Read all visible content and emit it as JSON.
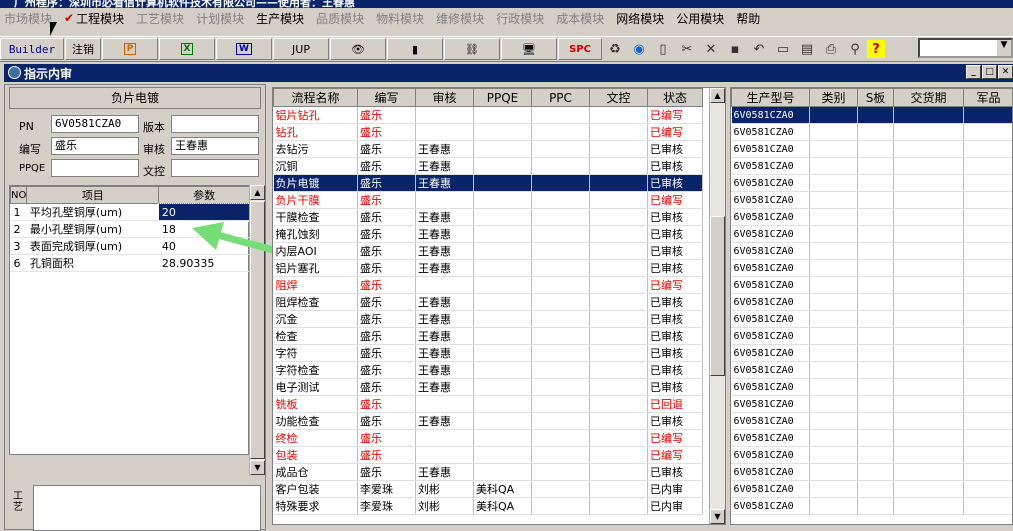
{
  "app": {
    "title": "广州程序：深圳市必看信计算机软件技术有限公司——使用者：王春惠"
  },
  "menu": [
    "市场模块",
    "工程模块",
    "工艺模块",
    "计划模块",
    "生产模块",
    "品质模块",
    "物料模块",
    "维修模块",
    "行政模块",
    "成本模块",
    "网络模块",
    "公用模块",
    "帮助"
  ],
  "toolbar": {
    "builder": "Builder",
    "logout": "注销",
    "jup": "JUP",
    "spc": "SPC"
  },
  "window": {
    "title": "指示内审"
  },
  "header": {
    "title": "负片电镀"
  },
  "form": {
    "pn_label": "PN",
    "pn_value": "6V0581CZA0",
    "version_label": "版本",
    "version_value": "",
    "author_label": "编写",
    "author_value": "盛乐",
    "review_label": "审核",
    "review_value": "王春惠",
    "ppqe_label": "PPQE",
    "ppqe_value": "",
    "control_label": "文控",
    "control_value": ""
  },
  "params": {
    "columns": [
      "NO",
      "项目",
      "参数"
    ],
    "rows": [
      {
        "no": "1",
        "item": "平均孔壁铜厚(um)",
        "value": "20"
      },
      {
        "no": "2",
        "item": "最小孔壁铜厚(um)",
        "value": "18"
      },
      {
        "no": "3",
        "item": "表面完成铜厚(um)",
        "value": "40"
      },
      {
        "no": "6",
        "item": "孔铜面积",
        "value": "28.90335"
      }
    ]
  },
  "side_label": "工艺",
  "flow": {
    "columns": [
      "流程名称",
      "编写",
      "审核",
      "PPQE",
      "PPC",
      "文控",
      "状态"
    ],
    "rows": [
      {
        "name": "铝片钻孔",
        "author": "盛乐",
        "review": "",
        "ppqe": "",
        "status": "已编写",
        "red": true
      },
      {
        "name": "钻孔",
        "author": "盛乐",
        "review": "",
        "ppqe": "",
        "status": "已编写",
        "red": true
      },
      {
        "name": "去钻污",
        "author": "盛乐",
        "review": "王春惠",
        "ppqe": "",
        "status": "已审核"
      },
      {
        "name": "沉铜",
        "author": "盛乐",
        "review": "王春惠",
        "ppqe": "",
        "status": "已审核"
      },
      {
        "name": "负片电镀",
        "author": "盛乐",
        "review": "王春惠",
        "ppqe": "",
        "status": "已审核",
        "hl": true
      },
      {
        "name": "负片干膜",
        "author": "盛乐",
        "review": "",
        "ppqe": "",
        "status": "已编写",
        "red": true
      },
      {
        "name": "干膜检查",
        "author": "盛乐",
        "review": "王春惠",
        "ppqe": "",
        "status": "已审核"
      },
      {
        "name": "掩孔蚀刻",
        "author": "盛乐",
        "review": "王春惠",
        "ppqe": "",
        "status": "已审核"
      },
      {
        "name": "内层AOI",
        "author": "盛乐",
        "review": "王春惠",
        "ppqe": "",
        "status": "已审核"
      },
      {
        "name": "铝片塞孔",
        "author": "盛乐",
        "review": "王春惠",
        "ppqe": "",
        "status": "已审核"
      },
      {
        "name": "阻焊",
        "author": "盛乐",
        "review": "",
        "ppqe": "",
        "status": "已编写",
        "red": true
      },
      {
        "name": "阻焊检查",
        "author": "盛乐",
        "review": "王春惠",
        "ppqe": "",
        "status": "已审核"
      },
      {
        "name": "沉金",
        "author": "盛乐",
        "review": "王春惠",
        "ppqe": "",
        "status": "已审核"
      },
      {
        "name": "检查",
        "author": "盛乐",
        "review": "王春惠",
        "ppqe": "",
        "status": "已审核"
      },
      {
        "name": "字符",
        "author": "盛乐",
        "review": "王春惠",
        "ppqe": "",
        "status": "已审核"
      },
      {
        "name": "字符检查",
        "author": "盛乐",
        "review": "王春惠",
        "ppqe": "",
        "status": "已审核"
      },
      {
        "name": "电子测试",
        "author": "盛乐",
        "review": "王春惠",
        "ppqe": "",
        "status": "已审核"
      },
      {
        "name": "铣板",
        "author": "盛乐",
        "review": "",
        "ppqe": "",
        "status": "已回退",
        "red": true
      },
      {
        "name": "功能检查",
        "author": "盛乐",
        "review": "王春惠",
        "ppqe": "",
        "status": "已审核"
      },
      {
        "name": "终检",
        "author": "盛乐",
        "review": "",
        "ppqe": "",
        "status": "已编写",
        "red": true
      },
      {
        "name": "包装",
        "author": "盛乐",
        "review": "",
        "ppqe": "",
        "status": "已编写",
        "red": true
      },
      {
        "name": "成品仓",
        "author": "盛乐",
        "review": "王春惠",
        "ppqe": "",
        "status": "已审核"
      },
      {
        "name": "客户包装",
        "author": "李爱珠",
        "review": "刘彬",
        "ppqe": "美科QA",
        "status": "已内审"
      },
      {
        "name": "特殊要求",
        "author": "李爱珠",
        "review": "刘彬",
        "ppqe": "美科QA",
        "status": "已内审"
      }
    ]
  },
  "prod": {
    "columns": [
      "生产型号",
      "类别",
      "S板",
      "交货期",
      "军品"
    ],
    "rows": [
      "6V0581CZA0",
      "6V0581CZA0",
      "6V0581CZA0",
      "6V0581CZA0",
      "6V0581CZA0",
      "6V0581CZA0",
      "6V0581CZA0",
      "6V0581CZA0",
      "6V0581CZA0",
      "6V0581CZA0",
      "6V0581CZA0",
      "6V0581CZA0",
      "6V0581CZA0",
      "6V0581CZA0",
      "6V0581CZA0",
      "6V0581CZA0",
      "6V0581CZA0",
      "6V0581CZA0",
      "6V0581CZA0",
      "6V0581CZA0",
      "6V0581CZA0",
      "6V0581CZA0",
      "6V0581CZA0",
      "6V0581CZA0"
    ]
  }
}
